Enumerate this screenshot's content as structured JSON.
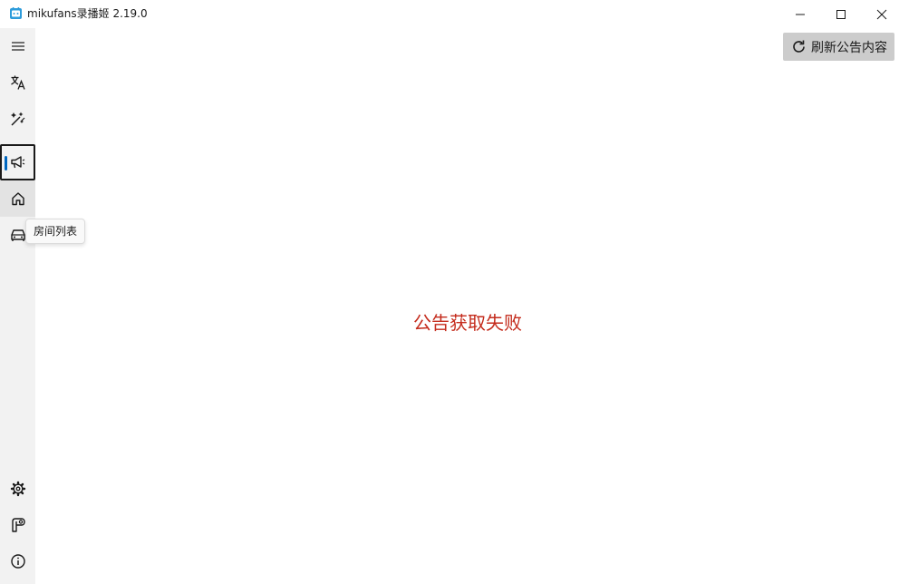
{
  "window": {
    "title": "mikufans录播姬 2.19.0",
    "controls": {
      "minimize": "minimize",
      "maximize": "maximize",
      "close": "close"
    }
  },
  "sidebar": {
    "top_items": [
      {
        "id": "menu",
        "icon": "hamburger-menu-icon"
      },
      {
        "id": "translate",
        "icon": "translate-icon"
      },
      {
        "id": "tools",
        "icon": "magic-wand-icon"
      },
      {
        "id": "announcement",
        "icon": "megaphone-icon",
        "selected": true
      },
      {
        "id": "home",
        "icon": "home-icon",
        "hover": true
      },
      {
        "id": "rooms",
        "icon": "car-icon"
      }
    ],
    "bottom_items": [
      {
        "id": "settings",
        "icon": "gear-icon"
      },
      {
        "id": "logs",
        "icon": "log-icon"
      },
      {
        "id": "about",
        "icon": "info-icon"
      }
    ],
    "accent_color": "#0067c0"
  },
  "tooltip": {
    "text": "房间列表"
  },
  "toolbar": {
    "refresh_label": "刷新公告内容",
    "refresh_icon": "refresh-icon"
  },
  "main": {
    "message": "公告获取失败",
    "message_color": "#c42b1c"
  }
}
